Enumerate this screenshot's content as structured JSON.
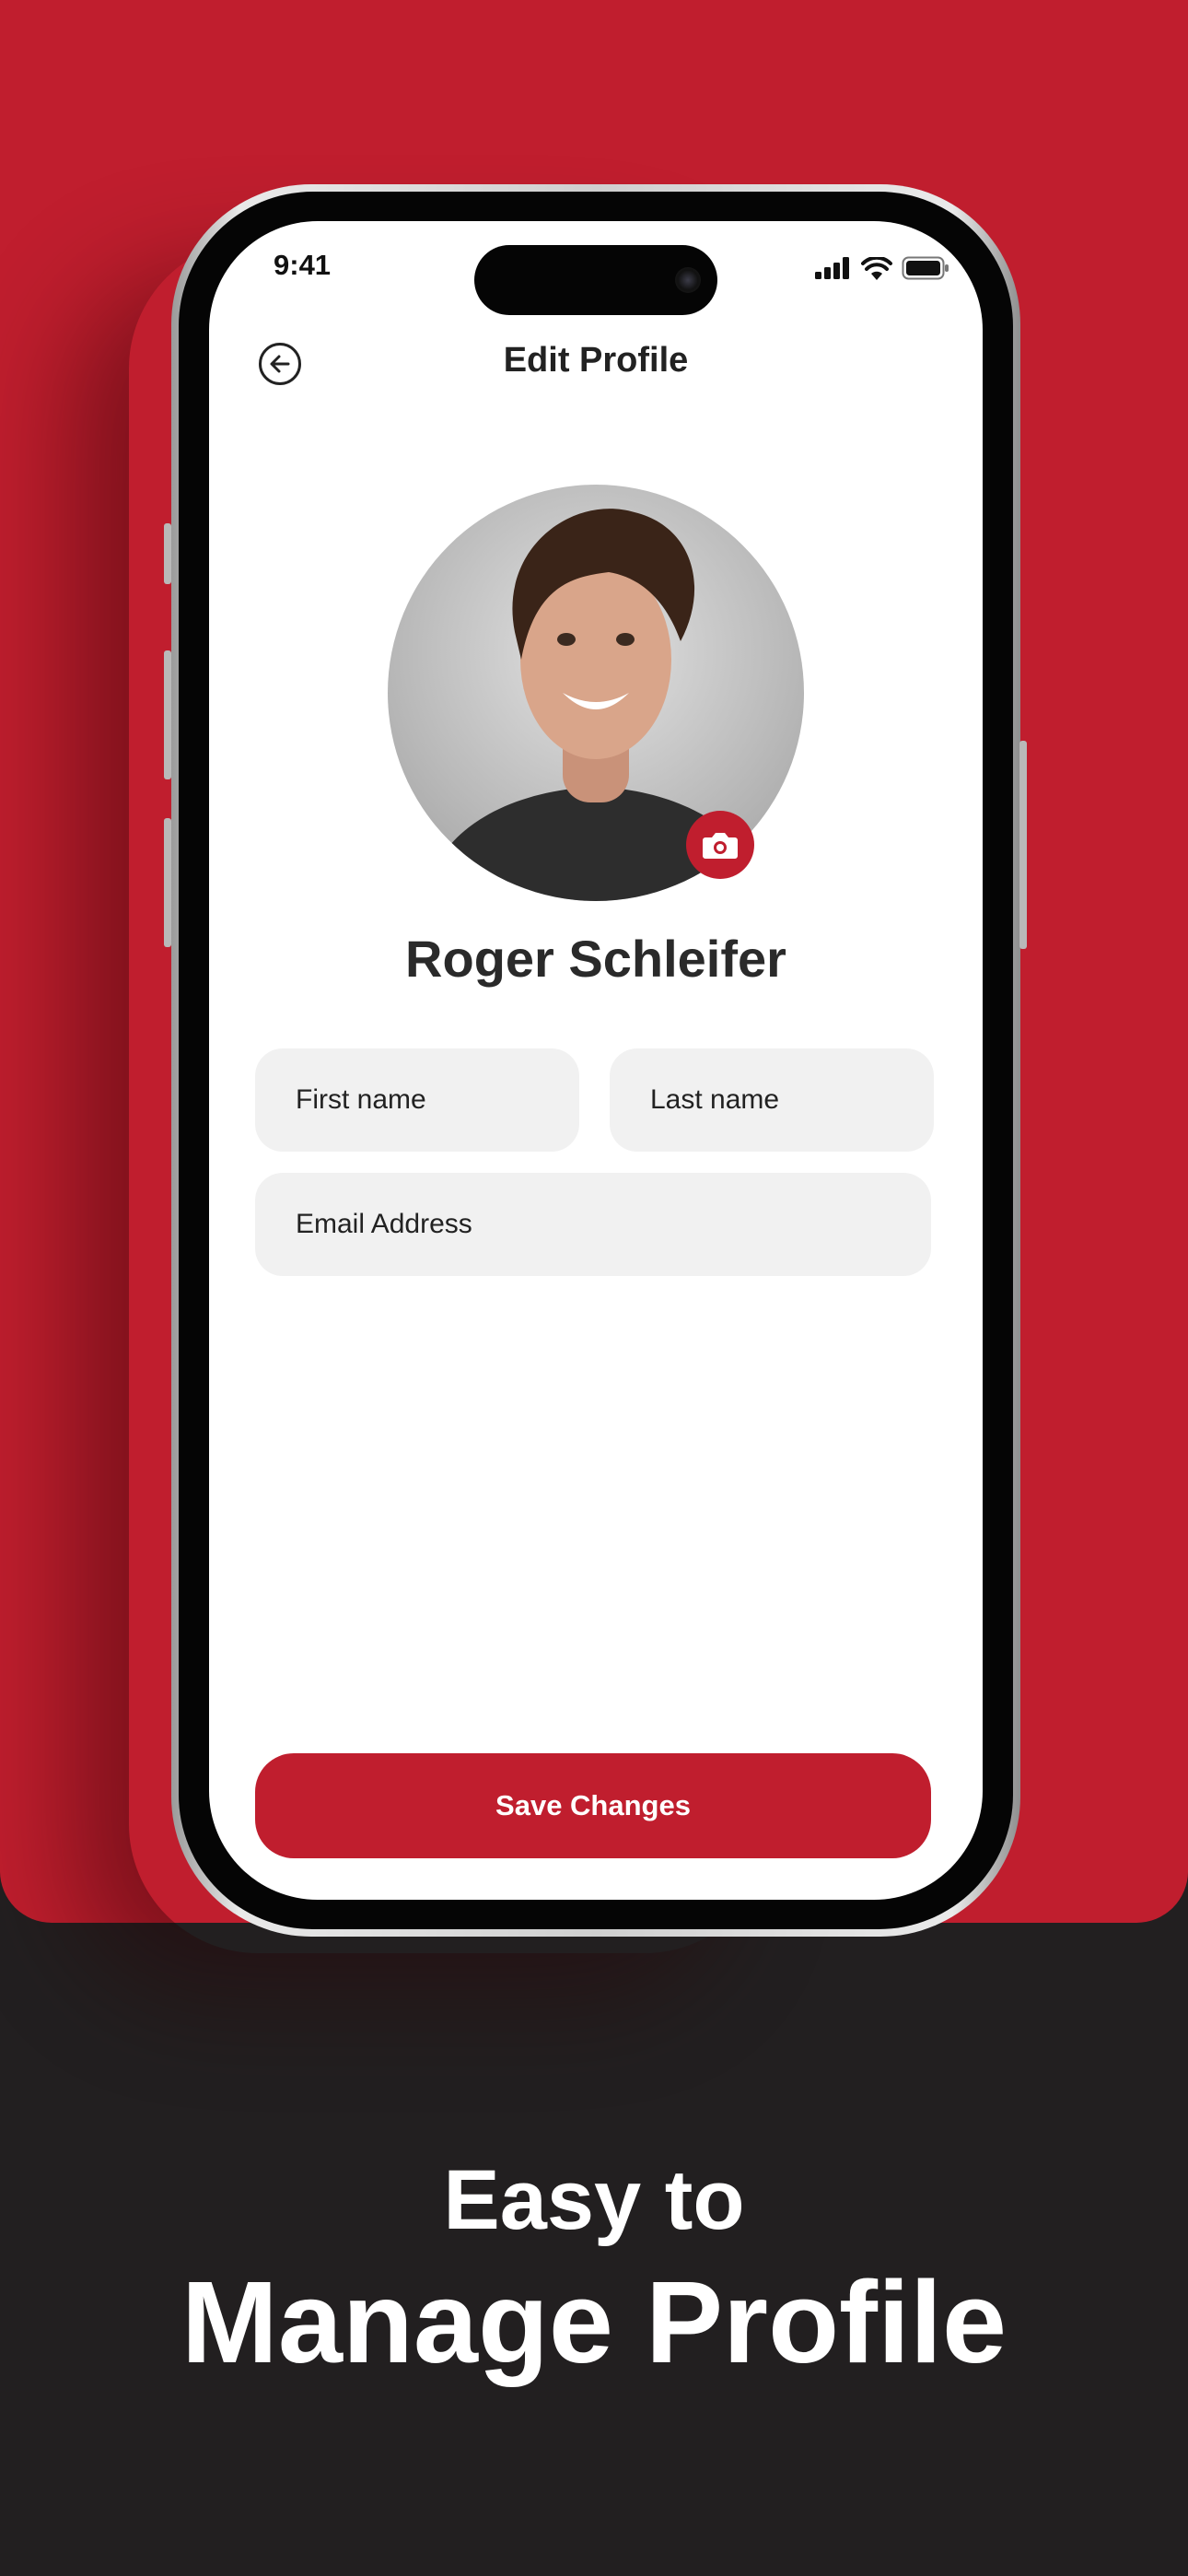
{
  "status_bar": {
    "time": "9:41"
  },
  "header": {
    "title": "Edit Profile"
  },
  "profile": {
    "name": "Roger Schleifer"
  },
  "form": {
    "first_name_placeholder": "First name",
    "last_name_placeholder": "Last name",
    "email_placeholder": "Email Address"
  },
  "actions": {
    "save_label": "Save Changes"
  },
  "tagline": {
    "line1": "Easy to",
    "line2": "Manage Profile"
  },
  "colors": {
    "brand": "#c01e2e",
    "background_dark": "#221f20",
    "field_bg": "#f1f1f1"
  },
  "icons": [
    "back-arrow-icon",
    "camera-icon",
    "signal-icon",
    "wifi-icon",
    "battery-icon"
  ]
}
